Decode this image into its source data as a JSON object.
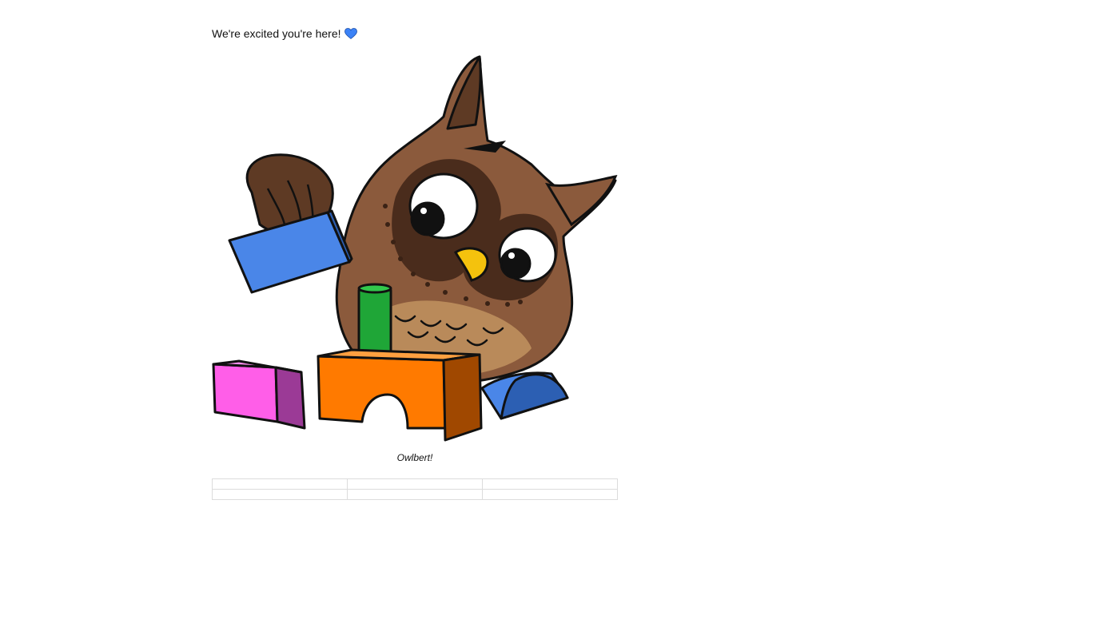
{
  "intro": {
    "text": "We're excited you're here!",
    "heart_icon": "blue-heart-icon",
    "heart_color": "#3b82f6"
  },
  "figure": {
    "illustration": "owl-playing-with-blocks",
    "caption": "Owlbert!",
    "colors": {
      "owl_body": "#8b5a3c",
      "owl_dark": "#4a2c1c",
      "owl_belly": "#b98a5a",
      "beak": "#f4c20d",
      "block_blue": "#4a86e8",
      "block_green": "#1fa637",
      "block_orange": "#ff7a00",
      "block_pink": "#ff5ee8"
    }
  },
  "table": {
    "rows": [
      [
        "",
        "",
        ""
      ],
      [
        "",
        "",
        ""
      ]
    ]
  }
}
